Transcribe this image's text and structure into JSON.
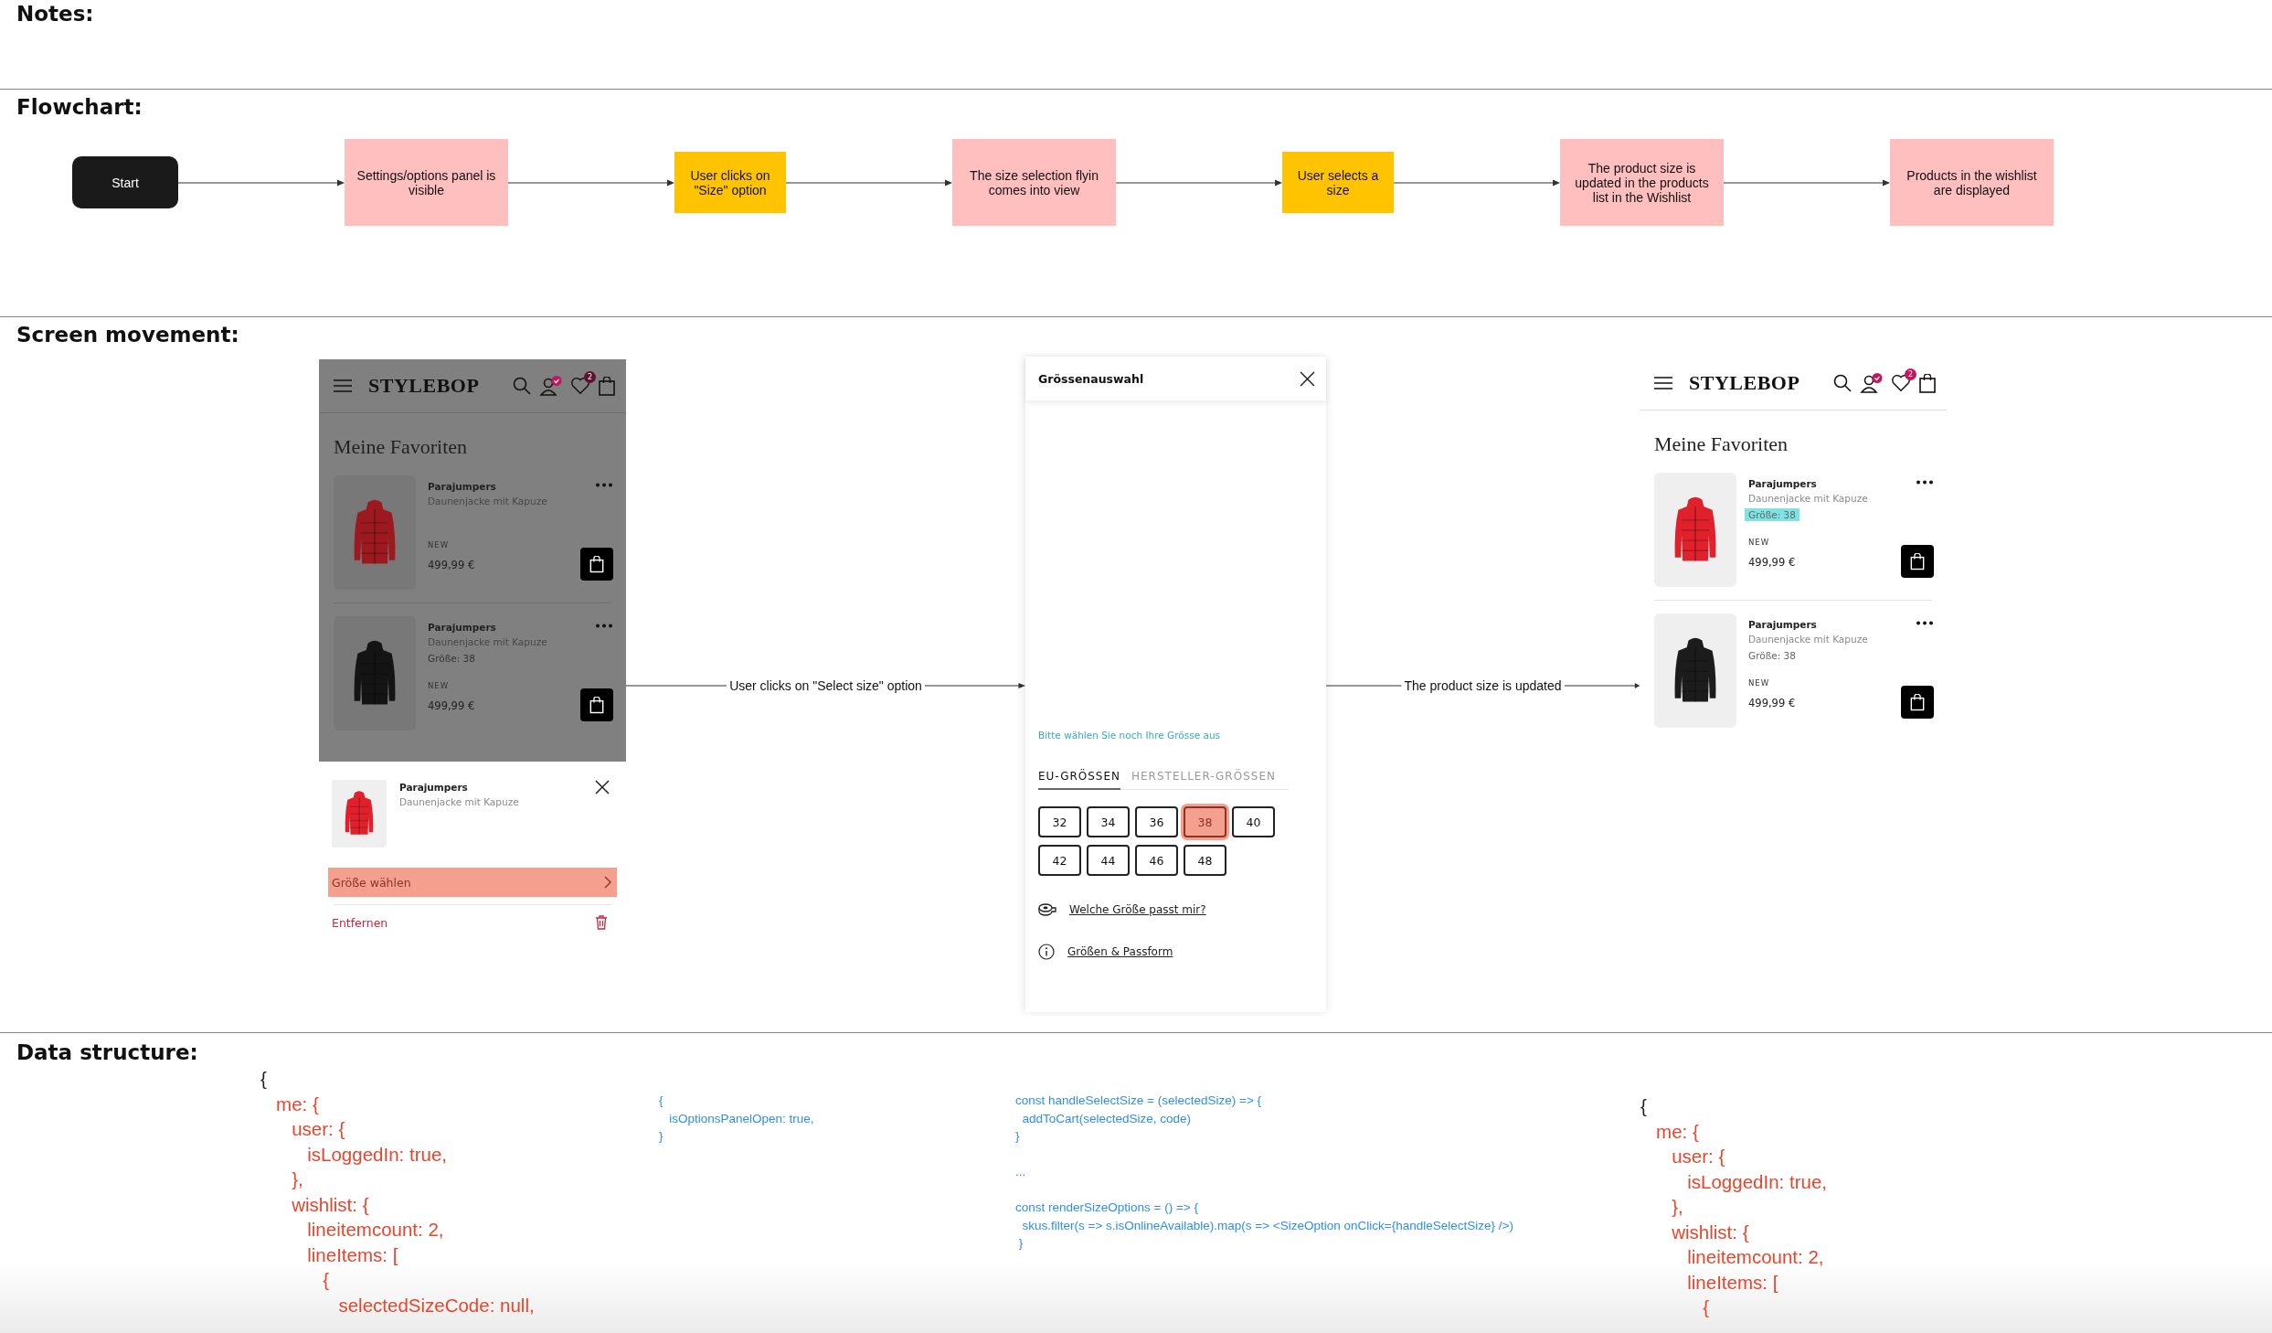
{
  "notes": {
    "heading": "Notes:"
  },
  "flowchart": {
    "heading": "Flowchart:",
    "nodes": [
      {
        "kind": "start",
        "label": "Start"
      },
      {
        "kind": "state",
        "label": "Settings/options panel is visible"
      },
      {
        "kind": "action",
        "label": "User clicks on \"Size\" option"
      },
      {
        "kind": "state",
        "label": "The size selection flyin comes into view"
      },
      {
        "kind": "action",
        "label": "User selects a size"
      },
      {
        "kind": "state",
        "label": "The product size is updated in the products list in the Wishlist"
      },
      {
        "kind": "state",
        "label": "Products in the wishlist are displayed"
      }
    ]
  },
  "screen_movement": {
    "heading": "Screen movement:",
    "steps": [
      {
        "kind": "phone",
        "dimmed": true,
        "logo": "STYLEBOP",
        "wishlist_badge": "2",
        "title": "Meine Favoriten",
        "items": [
          {
            "brand": "Parajumpers",
            "name": "Daunenjacke mit Kapuze",
            "tag": "NEW",
            "price": "499,99 €",
            "color": "#9c1a1f"
          },
          {
            "brand": "Parajumpers",
            "name": "Daunenjacke mit Kapuze",
            "size": "Größe: 38",
            "size_highlighted": false,
            "tag": "NEW",
            "price": "499,99 €",
            "color": "#141414"
          }
        ],
        "sheet": {
          "brand": "Parajumpers",
          "name": "Daunenjacke mit Kapuze",
          "color": "#e0202a",
          "action": "Größe wählen",
          "remove": "Entfernen"
        }
      },
      {
        "kind": "transition",
        "label": "User clicks on \"Select size\" option"
      },
      {
        "kind": "flyin",
        "title": "Grössenauswahl",
        "hint": "Bitte wählen Sie noch Ihre Grösse aus",
        "tabs": [
          {
            "label": "EU-GRÖSSEN",
            "selected": true
          },
          {
            "label": "HERSTELLER-GRÖSSEN",
            "selected": false
          }
        ],
        "sizes": [
          {
            "label": "32",
            "selected": false
          },
          {
            "label": "34",
            "selected": false
          },
          {
            "label": "36",
            "selected": false
          },
          {
            "label": "38",
            "selected": true
          },
          {
            "label": "40",
            "selected": false
          },
          {
            "label": "42",
            "selected": false
          },
          {
            "label": "44",
            "selected": false
          },
          {
            "label": "46",
            "selected": false
          },
          {
            "label": "48",
            "selected": false
          }
        ],
        "links": [
          {
            "kind": "tape",
            "label": "Welche Größe passt mir?"
          },
          {
            "kind": "info",
            "label": "Größen & Passform"
          }
        ]
      },
      {
        "kind": "transition",
        "label": "The product size is updated"
      },
      {
        "kind": "phone",
        "dimmed": false,
        "logo": "STYLEBOP",
        "wishlist_badge": "2",
        "title": "Meine Favoriten",
        "items": [
          {
            "brand": "Parajumpers",
            "name": "Daunenjacke mit Kapuze",
            "size": "Größe: 38",
            "size_highlighted": true,
            "tag": "NEW",
            "price": "499,99 €",
            "color": "#e0202a"
          },
          {
            "brand": "Parajumpers",
            "name": "Daunenjacke mit Kapuze",
            "size": "Größe: 38",
            "size_highlighted": false,
            "tag": "NEW",
            "price": "499,99 €",
            "color": "#1c1c1c"
          }
        ]
      }
    ]
  },
  "data_structure": {
    "heading": "Data structure:",
    "blocks": [
      {
        "kind": "large",
        "groups": [
          {
            "color": "#222222",
            "lines": [
              "{"
            ]
          },
          {
            "color": "#e8452c",
            "lines": [
              "   me: {",
              "      user: {",
              "         isLoggedIn: true,",
              "      },",
              "      wishlist: {",
              "         lineitemcount: 2,",
              "         lineItems: [",
              "            {",
              "               selectedSizeCode: null,"
            ]
          }
        ]
      },
      {
        "kind": "small",
        "groups": [
          {
            "lines": [
              "{",
              "   isOptionsPanelOpen: true,",
              "}"
            ]
          }
        ]
      },
      {
        "kind": "small",
        "groups": [
          {
            "lines": [
              "const handleSelectSize = (selectedSize) => {",
              "  addToCart(selectedSize, code)",
              "}"
            ]
          },
          {
            "lines": [
              "..."
            ]
          },
          {
            "lines": [
              "const renderSizeOptions = () => {",
              "  skus.filter(s => s.isOnlineAvailable).map(s => <SizeOption onClick={handleSelectSize} />)",
              " }"
            ]
          }
        ]
      },
      {
        "kind": "large",
        "groups": [
          {
            "color": "#222222",
            "lines": [
              "{"
            ]
          },
          {
            "color": "#e8452c",
            "lines": [
              "   me: {",
              "      user: {",
              "         isLoggedIn: true,",
              "      },",
              "      wishlist: {",
              "         lineitemcount: 2,",
              "         lineItems: [",
              "            {"
            ]
          }
        ]
      }
    ]
  }
}
